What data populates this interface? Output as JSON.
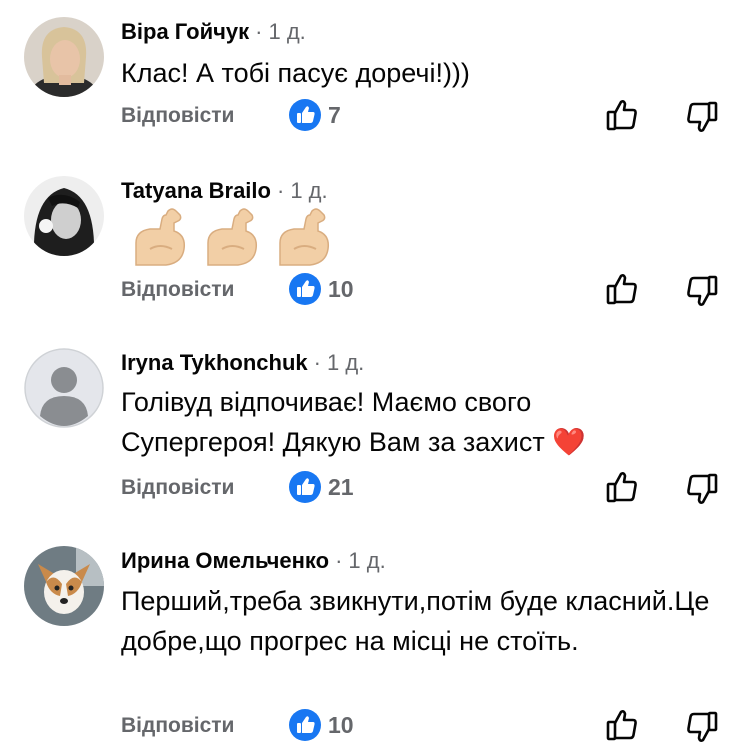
{
  "comments": [
    {
      "author": "Віра Гойчук",
      "time": "1 д.",
      "text": "Клас! А тобі пасує доречі!)))",
      "reply_label": "Відповісти",
      "likes": "7",
      "avatar": "photo-avatar-woman-blonde"
    },
    {
      "author": "Tatyana Brailo",
      "time": "1 д.",
      "text": "",
      "emojis": [
        "flexed-biceps",
        "flexed-biceps",
        "flexed-biceps"
      ],
      "reply_label": "Відповісти",
      "likes": "10",
      "avatar": "photo-avatar-woman-bw"
    },
    {
      "author": "Iryna Tykhonchuk",
      "time": "1 д.",
      "text": "Голівуд відпочиває! Маємо свого Супергероя! Дякую Вам за захист ❤️",
      "reply_label": "Відповісти",
      "likes": "21",
      "avatar": "default-silhouette-avatar"
    },
    {
      "author": "Ирина Омельченко",
      "time": "1 д.",
      "text": "Перший,треба звикнути,потім буде класний.Це добре,що прогрес на місці не стоїть.",
      "reply_label": "Відповісти",
      "likes": "10",
      "avatar": "photo-avatar-dog"
    }
  ],
  "separator": "·",
  "colors": {
    "like_blue": "#1877f2",
    "secondary_text": "#65676b",
    "heart_red": "#e0242f"
  }
}
